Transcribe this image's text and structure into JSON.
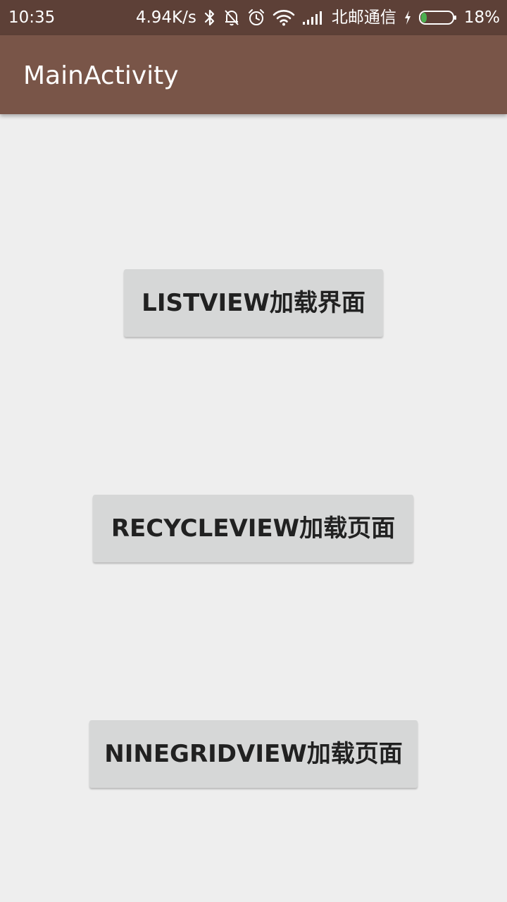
{
  "status_bar": {
    "time": "10:35",
    "network_speed": "4.94K/s",
    "carrier": "北邮通信",
    "battery_percent": "18%",
    "battery_level": 0.18,
    "icons": [
      "bluetooth-icon",
      "bell-off-icon",
      "alarm-icon",
      "wifi-icon",
      "signal-icon",
      "charging-icon",
      "battery-icon"
    ]
  },
  "app_bar": {
    "title": "MainActivity"
  },
  "buttons": [
    {
      "label": "LISTVIEW加载界面"
    },
    {
      "label": "RECYCLEVIEW加载页面"
    },
    {
      "label": "NINEGRIDVIEW加载页面"
    }
  ],
  "colors": {
    "status_bar": "#5d4037",
    "app_bar": "#795548",
    "background": "#eeeeee",
    "button": "#d6d7d7",
    "button_text": "#212121",
    "battery_fill": "#4caf50"
  }
}
